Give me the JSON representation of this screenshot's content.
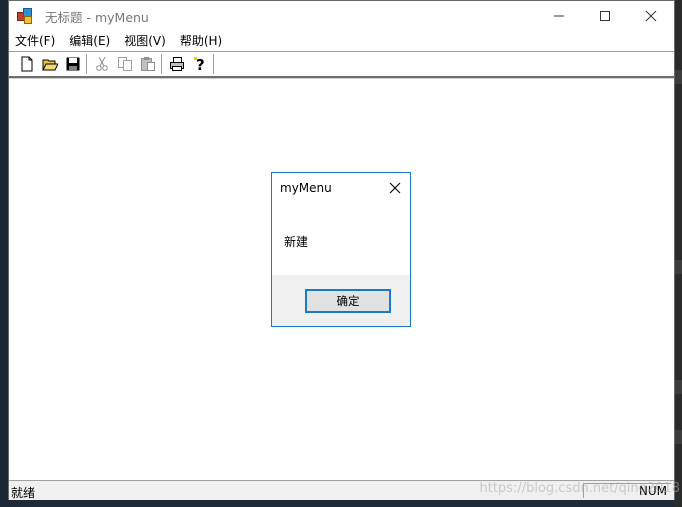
{
  "window": {
    "title": "无标题 - myMenu"
  },
  "menubar": {
    "items": [
      "文件(F)",
      "编辑(E)",
      "视图(V)",
      "帮助(H)"
    ]
  },
  "toolbar": {
    "icons": [
      "new-file-icon",
      "open-folder-icon",
      "save-icon",
      "cut-icon",
      "copy-icon",
      "paste-icon",
      "print-icon",
      "help-icon"
    ]
  },
  "statusbar": {
    "text": "就绪",
    "num": "NUM",
    "watermark": "https://blog.csdn.net/qing2018"
  },
  "dialog": {
    "title": "myMenu",
    "message": "新建",
    "ok_label": "确定"
  },
  "colors": {
    "accent": "#1979ca",
    "footer": "#f0f0f0"
  }
}
